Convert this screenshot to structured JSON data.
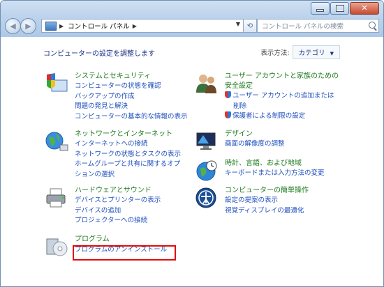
{
  "address": {
    "crumb": "コントロール パネル"
  },
  "search": {
    "placeholder": "コントロール パネルの検索"
  },
  "header": {
    "headline": "コンピューターの設定を調整します",
    "view_label": "表示方法:",
    "view_value": "カテゴリ"
  },
  "left_categories": [
    {
      "title": "システムとセキュリティ",
      "links": [
        "コンピューターの状態を確認",
        "バックアップの作成",
        "問題の発見と解決",
        "コンピューターの基本的な情報の表示"
      ]
    },
    {
      "title": "ネットワークとインターネット",
      "links": [
        "インターネットへの接続",
        "ネットワークの状態とタスクの表示",
        "ホームグループと共有に関するオプ",
        "ションの選択"
      ]
    },
    {
      "title": "ハードウェアとサウンド",
      "links": [
        "デバイスとプリンターの表示",
        "デバイスの追加",
        "プロジェクターへの接続"
      ]
    },
    {
      "title": "プログラム",
      "links": [
        "プログラムのアンインストール"
      ]
    }
  ],
  "right_categories": [
    {
      "title": "ユーザー アカウントと家族のための",
      "title2": "安全設定",
      "links": [
        "ユーザー アカウントの追加または",
        "削除",
        "保護者による制限の設定"
      ]
    },
    {
      "title": "デザイン",
      "links": [
        "画面の解像度の調整"
      ]
    },
    {
      "title": "時計、言語、および地域",
      "links": [
        "キーボードまたは入力方法の変更"
      ]
    },
    {
      "title": "コンピューターの簡単操作",
      "links": [
        "設定の提案の表示",
        "視覚ディスプレイの最適化"
      ]
    }
  ]
}
